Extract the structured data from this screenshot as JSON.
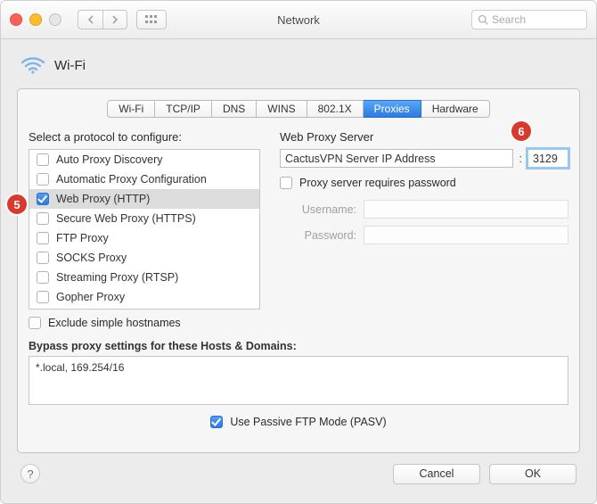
{
  "window": {
    "title": "Network",
    "search_placeholder": "Search"
  },
  "header": {
    "connection_label": "Wi-Fi"
  },
  "tabs": [
    {
      "label": "Wi-Fi",
      "active": false
    },
    {
      "label": "TCP/IP",
      "active": false
    },
    {
      "label": "DNS",
      "active": false
    },
    {
      "label": "WINS",
      "active": false
    },
    {
      "label": "802.1X",
      "active": false
    },
    {
      "label": "Proxies",
      "active": true
    },
    {
      "label": "Hardware",
      "active": false
    }
  ],
  "left": {
    "section_label": "Select a protocol to configure:",
    "protocols": [
      {
        "label": "Auto Proxy Discovery",
        "checked": false,
        "selected": false
      },
      {
        "label": "Automatic Proxy Configuration",
        "checked": false,
        "selected": false
      },
      {
        "label": "Web Proxy (HTTP)",
        "checked": true,
        "selected": true
      },
      {
        "label": "Secure Web Proxy (HTTPS)",
        "checked": false,
        "selected": false
      },
      {
        "label": "FTP Proxy",
        "checked": false,
        "selected": false
      },
      {
        "label": "SOCKS Proxy",
        "checked": false,
        "selected": false
      },
      {
        "label": "Streaming Proxy (RTSP)",
        "checked": false,
        "selected": false
      },
      {
        "label": "Gopher Proxy",
        "checked": false,
        "selected": false
      }
    ],
    "exclude_label": "Exclude simple hostnames",
    "exclude_checked": false
  },
  "right": {
    "section_label": "Web Proxy Server",
    "server_value": "CactusVPN Server IP Address",
    "colon": ":",
    "port_value": "3129",
    "requires_password_label": "Proxy server requires password",
    "requires_password_checked": false,
    "username_label": "Username:",
    "password_label": "Password:"
  },
  "bypass": {
    "label": "Bypass proxy settings for these Hosts & Domains:",
    "value": "*.local, 169.254/16"
  },
  "passive": {
    "label": "Use Passive FTP Mode (PASV)",
    "checked": true
  },
  "footer": {
    "help": "?",
    "cancel": "Cancel",
    "ok": "OK"
  },
  "callouts": {
    "c5": "5",
    "c6": "6"
  }
}
